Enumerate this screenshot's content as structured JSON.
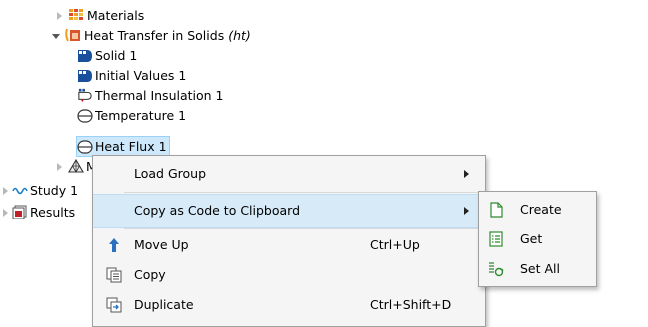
{
  "tree": {
    "materials": {
      "label": "Materials",
      "icon": "materials-icon"
    },
    "heat_transfer": {
      "label": "Heat Transfer in Solids ",
      "tag": "(ht)",
      "icon": "heat-transfer-icon"
    },
    "children": [
      {
        "label": "Solid 1",
        "icon": "solid-icon"
      },
      {
        "label": "Initial Values 1",
        "icon": "initial-values-icon"
      },
      {
        "label": "Thermal Insulation 1",
        "icon": "thermal-insulation-icon"
      },
      {
        "label": "Temperature 1",
        "icon": "boundary-condition-icon"
      },
      {
        "label": "Heat Flux 1",
        "icon": "boundary-condition-icon"
      }
    ],
    "mesh": {
      "label": "Me",
      "icon": "mesh-icon"
    },
    "study": {
      "label": "Study 1",
      "icon": "study-icon"
    },
    "results": {
      "label": "Results",
      "icon": "results-icon"
    }
  },
  "context_menu": {
    "load_group": "Load Group",
    "copy_as_code": "Copy as Code to Clipboard",
    "move_up": "Move Up",
    "move_up_shortcut": "Ctrl+Up",
    "copy": "Copy",
    "duplicate": "Duplicate",
    "duplicate_shortcut": "Ctrl+Shift+D"
  },
  "submenu": {
    "create": "Create",
    "get": "Get",
    "set_all": "Set All"
  },
  "colors": {
    "selection": "#cde8fb",
    "menu_highlight": "#d7eaf8",
    "node_blue": "#1a4f9c",
    "materials_orange": "#f0a020"
  }
}
